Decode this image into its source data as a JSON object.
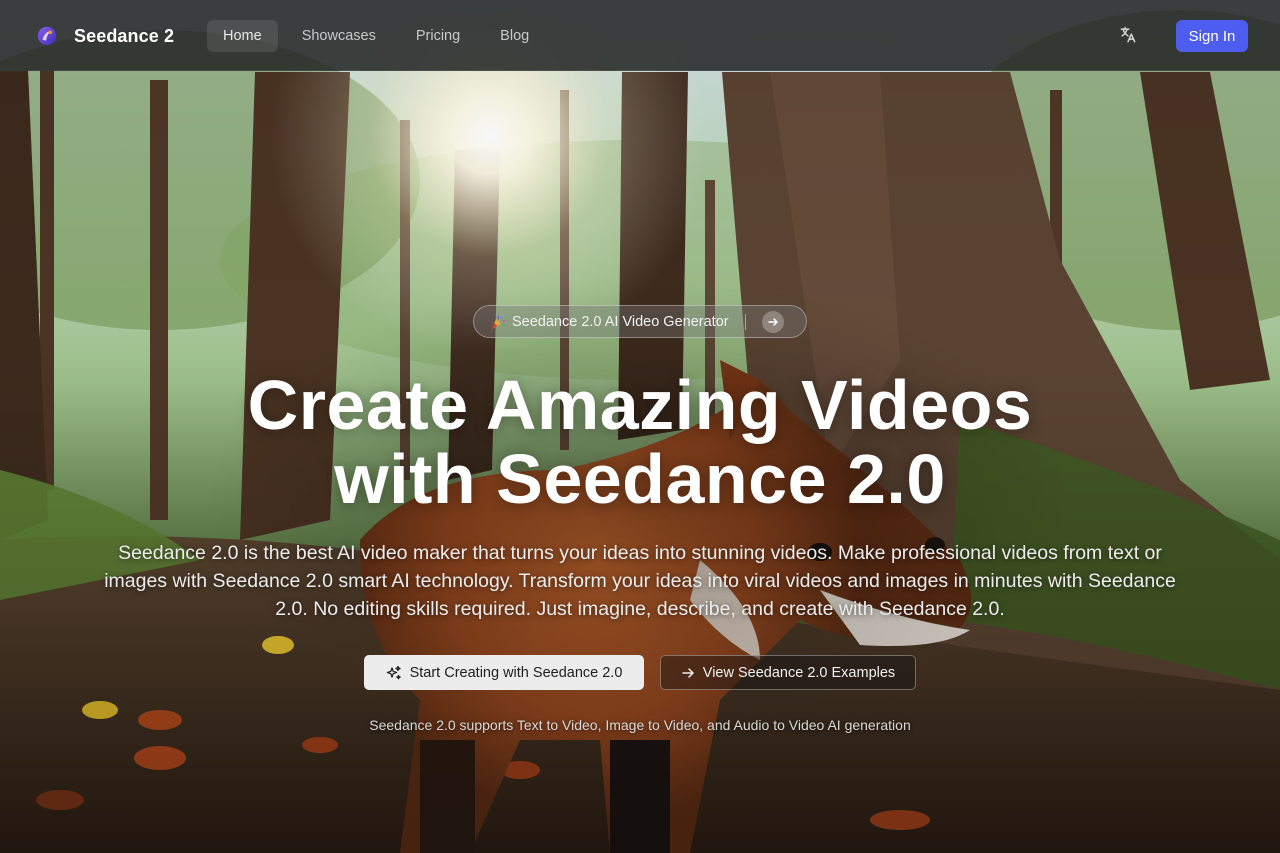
{
  "navbar": {
    "brand_name": "Seedance 2",
    "links": [
      {
        "label": "Home",
        "active": true
      },
      {
        "label": "Showcases"
      },
      {
        "label": "Pricing"
      },
      {
        "label": "Blog"
      }
    ],
    "language_icon": "translate-icon",
    "sign_in_label": "Sign In"
  },
  "hero": {
    "badge": {
      "emoji_icon": "party-popper-icon",
      "label": "Seedance 2.0 AI Video Generator",
      "arrow_icon": "arrow-right-icon"
    },
    "title_line1": "Create Amazing Videos",
    "title_line2": "with Seedance 2.0",
    "description": "Seedance 2.0 is the best AI video maker that turns your ideas into stunning videos. Make professional videos from text or images with Seedance 2.0 smart AI technology. Transform your ideas into viral videos and images in minutes with Seedance 2.0. No editing skills required. Just imagine, describe, and create with Seedance 2.0.",
    "primary_cta": {
      "label": "Start Creating with Seedance 2.0",
      "icon": "sparkles-icon"
    },
    "secondary_cta": {
      "label": "View Seedance 2.0 Examples",
      "icon": "arrow-right-icon"
    },
    "support_text": "Seedance 2.0 supports Text to Video, Image to Video, and Audio to Video AI generation"
  },
  "colors": {
    "accent": "#4c5df0",
    "navbar_bg": "#262828",
    "primary_cta_bg": "#ececec",
    "text_primary": "#ffffff"
  }
}
